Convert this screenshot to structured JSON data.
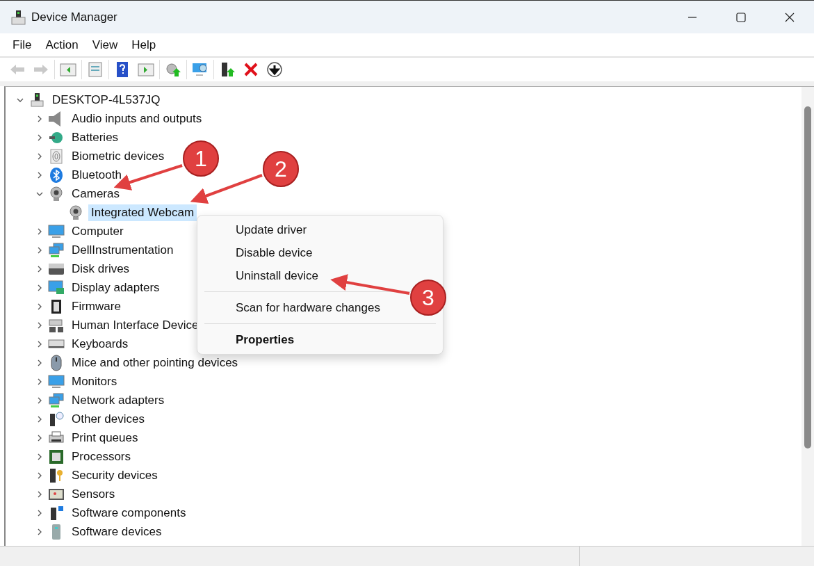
{
  "window": {
    "title": "Device Manager"
  },
  "menu_bar": [
    "File",
    "Action",
    "View",
    "Help"
  ],
  "toolbar": [
    [
      {
        "disabled": true
      },
      {
        "disabled": true
      }
    ],
    [
      {
        "disabled": false
      }
    ],
    [
      {
        "disabled": false
      }
    ],
    [
      {
        "disabled": false
      },
      {
        "disabled": false
      }
    ],
    [
      {
        "disabled": false
      }
    ],
    [
      {
        "disabled": false
      }
    ],
    [
      {
        "disabled": false
      },
      {
        "disabled": false
      },
      {
        "disabled": false
      }
    ]
  ],
  "tree": {
    "label": "DESKTOP-4L537JQ",
    "expanded": true,
    "selected": false,
    "children": [
      {
        "label": "Audio inputs and outputs",
        "expanded": false,
        "selected": false
      },
      {
        "label": "Batteries",
        "expanded": false,
        "selected": false
      },
      {
        "label": "Biometric devices",
        "expanded": false,
        "selected": false
      },
      {
        "label": "Bluetooth",
        "expanded": false,
        "selected": false
      },
      {
        "label": "Cameras",
        "expanded": true,
        "selected": false,
        "children": [
          {
            "label": "Integrated Webcam",
            "selected": true
          }
        ]
      },
      {
        "label": "Computer",
        "expanded": false,
        "selected": false
      },
      {
        "label": "DellInstrumentation",
        "expanded": false,
        "selected": false
      },
      {
        "label": "Disk drives",
        "expanded": false,
        "selected": false
      },
      {
        "label": "Display adapters",
        "expanded": false,
        "selected": false
      },
      {
        "label": "Firmware",
        "expanded": false,
        "selected": false
      },
      {
        "label": "Human Interface Device",
        "expanded": false,
        "selected": false
      },
      {
        "label": "Keyboards",
        "expanded": false,
        "selected": false
      },
      {
        "label": "Mice and other pointing devices",
        "expanded": false,
        "selected": false
      },
      {
        "label": "Monitors",
        "expanded": false,
        "selected": false
      },
      {
        "label": "Network adapters",
        "expanded": false,
        "selected": false
      },
      {
        "label": "Other devices",
        "expanded": false,
        "selected": false
      },
      {
        "label": "Print queues",
        "expanded": false,
        "selected": false
      },
      {
        "label": "Processors",
        "expanded": false,
        "selected": false
      },
      {
        "label": "Security devices",
        "expanded": false,
        "selected": false
      },
      {
        "label": "Sensors",
        "expanded": false,
        "selected": false
      },
      {
        "label": "Software components",
        "expanded": false,
        "selected": false
      },
      {
        "label": "Software devices",
        "expanded": false,
        "selected": false
      }
    ]
  },
  "context_menu": [
    [
      {
        "label": "Update driver",
        "default": false
      },
      {
        "label": "Disable device",
        "default": false
      },
      {
        "label": "Uninstall device",
        "default": false
      }
    ],
    [
      {
        "label": "Scan for hardware changes",
        "default": false
      }
    ],
    [
      {
        "label": "Properties",
        "default": true
      }
    ]
  ],
  "annotations": [
    {
      "label": "1"
    },
    {
      "label": "2"
    },
    {
      "label": "3"
    }
  ]
}
